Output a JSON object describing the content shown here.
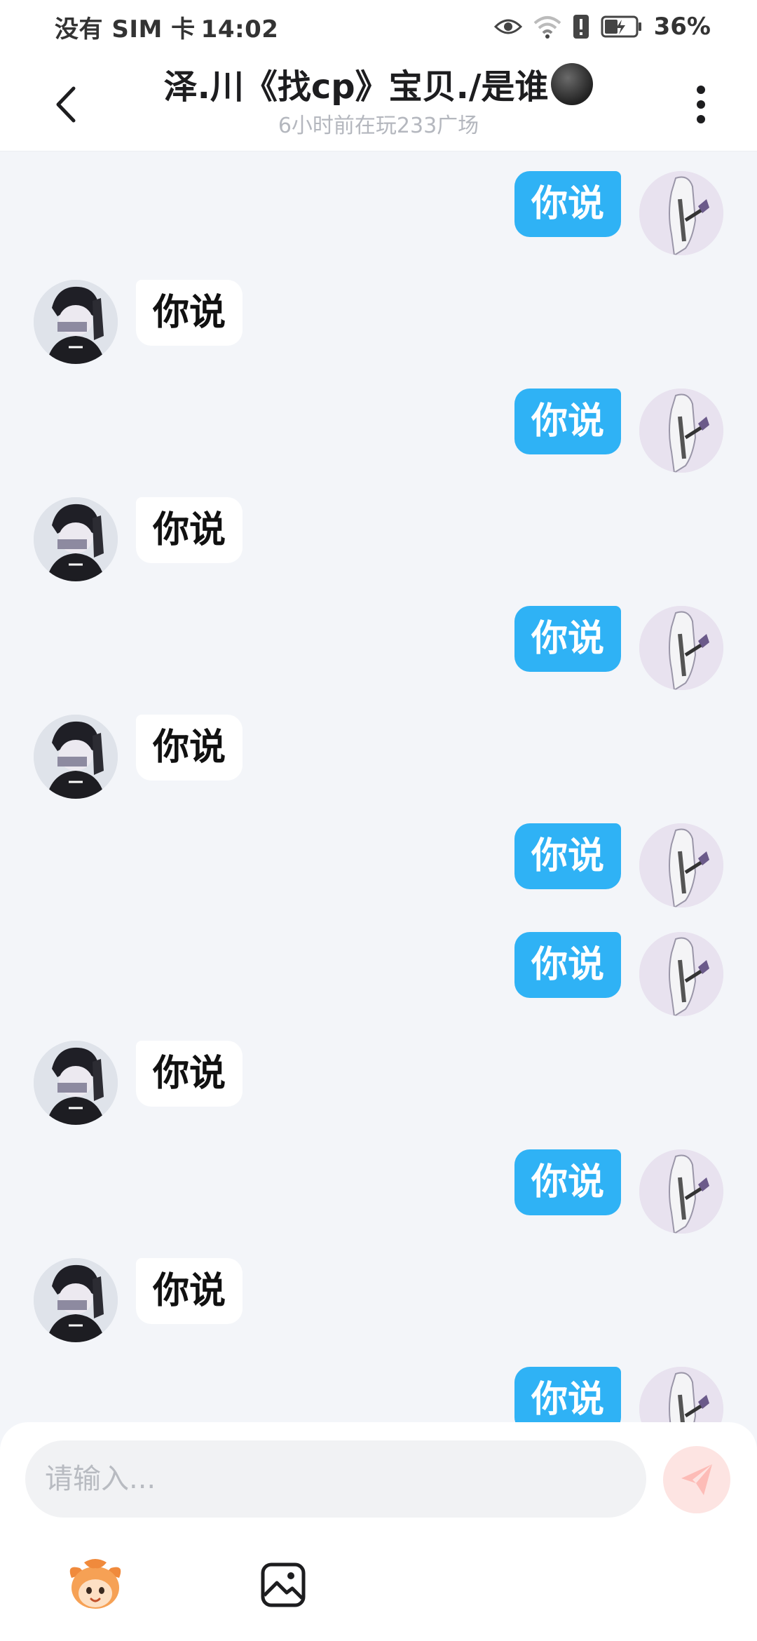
{
  "status_bar": {
    "carrier": "没有 SIM 卡",
    "time": "14:02",
    "battery": "36%",
    "icons": [
      "eye-icon",
      "wifi-icon",
      "alert-icon",
      "battery-icon"
    ]
  },
  "header": {
    "title": "泽.川《找cp》宝贝./是谁",
    "subtitle": "6小时前在玩233广场",
    "icons": [
      "back-arrow-icon",
      "more-vertical-icon"
    ]
  },
  "colors": {
    "accent": "#2fb2f5",
    "background": "#f3f5f9",
    "bubble_other": "#ffffff",
    "send_button": "#fde4e2"
  },
  "messages": [
    {
      "side": "right",
      "text": "你说"
    },
    {
      "side": "left",
      "text": "你说"
    },
    {
      "side": "right",
      "text": "你说"
    },
    {
      "side": "left",
      "text": "你说"
    },
    {
      "side": "right",
      "text": "你说"
    },
    {
      "side": "left",
      "text": "你说"
    },
    {
      "side": "right",
      "text": "你说"
    },
    {
      "side": "right",
      "text": "你说"
    },
    {
      "side": "left",
      "text": "你说"
    },
    {
      "side": "right",
      "text": "你说"
    },
    {
      "side": "left",
      "text": "你说"
    },
    {
      "side": "right",
      "text": "你说"
    }
  ],
  "composer": {
    "placeholder": "请输入...",
    "value": "",
    "icons": [
      "send-icon",
      "emoji-mascot-icon",
      "image-icon"
    ]
  }
}
